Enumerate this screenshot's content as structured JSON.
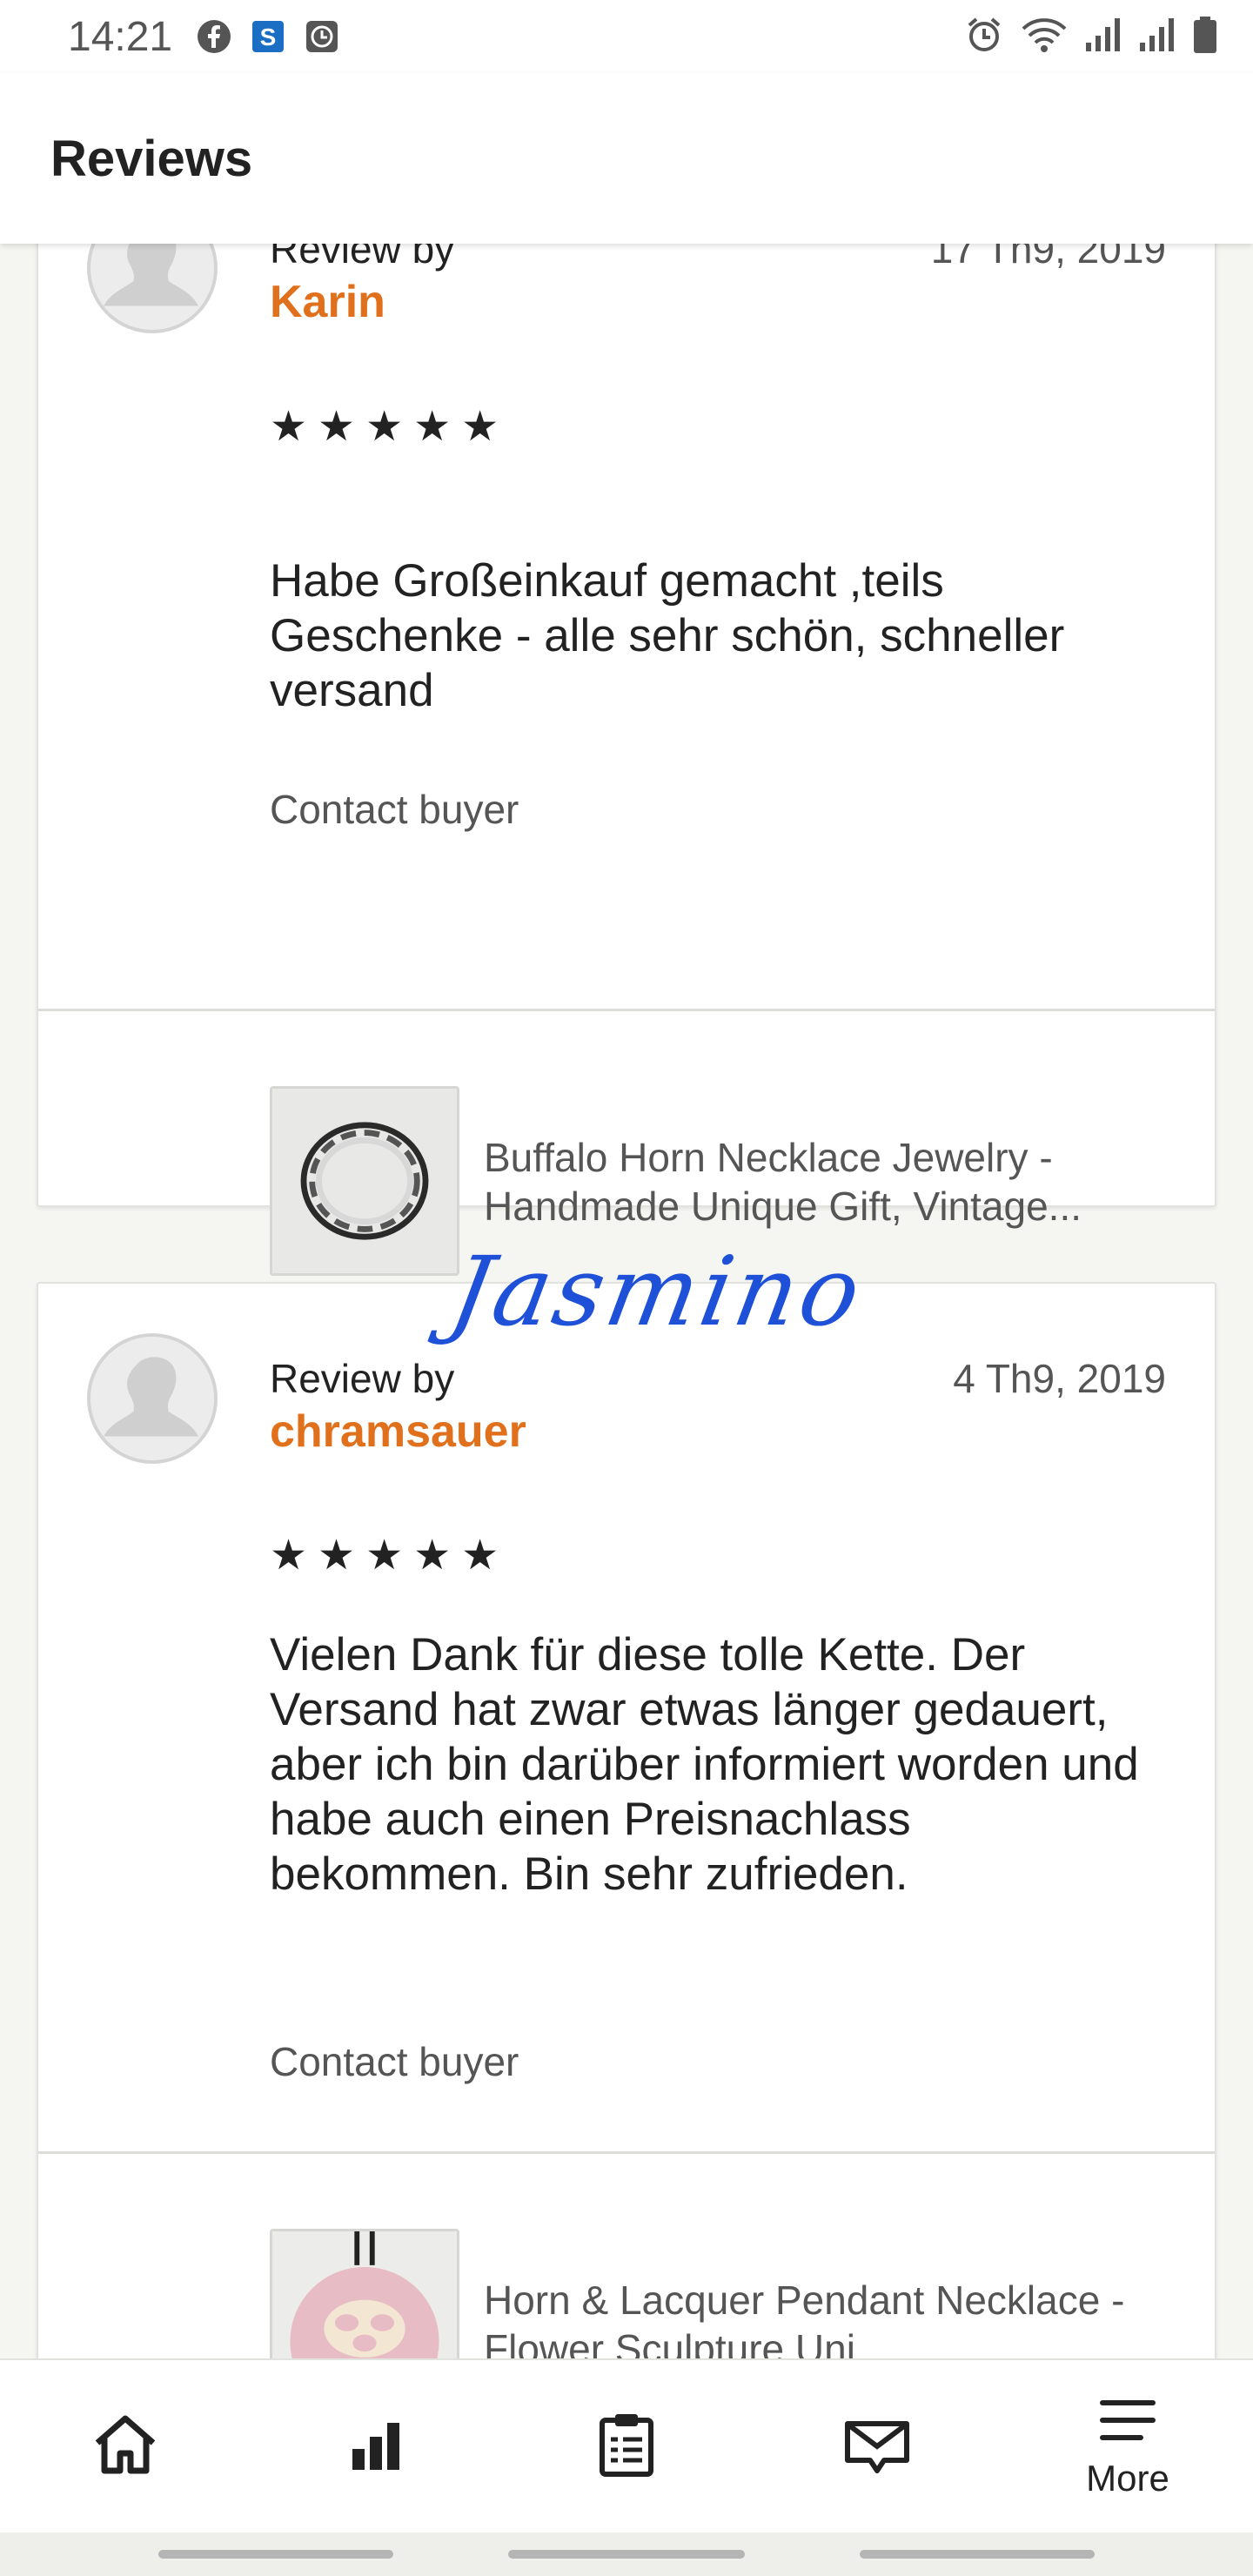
{
  "status_bar": {
    "time": "14:21",
    "notification_icons": [
      "facebook-icon",
      "s-app-icon",
      "clock-app-icon"
    ],
    "system_icons": [
      "alarm-icon",
      "wifi-icon",
      "signal-icon",
      "signal-icon",
      "battery-icon"
    ]
  },
  "app_bar": {
    "title": "Reviews"
  },
  "reviews": [
    {
      "review_by_label": "Review by",
      "reviewer": "Karin",
      "date": "17 Th9, 2019",
      "stars": "★★★★★",
      "rating": 5,
      "text": "Habe Großeinkauf gemacht ,teils Geschenke - alle sehr schön, schneller versand",
      "contact_label": "Contact buyer",
      "item_title": "Buffalo Horn Necklace Jewelry - Handmade Unique Gift, Vintage..."
    },
    {
      "review_by_label": "Review by",
      "reviewer": "chramsauer",
      "date": "4 Th9, 2019",
      "stars": "★★★★★",
      "rating": 5,
      "text": "Vielen Dank für diese tolle Kette. Der Versand hat zwar etwas länger gedauert, aber ich bin darüber informiert worden und habe auch einen Preisnachlass bekommen. Bin sehr zufrieden.",
      "contact_label": "Contact buyer",
      "item_title": "Horn & Lacquer Pendant Necklace - Flower Sculpture Uni..."
    }
  ],
  "signature_text": "Jasmino",
  "bottom_nav": {
    "items": [
      {
        "icon": "home-icon",
        "label": ""
      },
      {
        "icon": "stats-icon",
        "label": ""
      },
      {
        "icon": "orders-icon",
        "label": ""
      },
      {
        "icon": "messages-icon",
        "label": ""
      },
      {
        "icon": "menu-icon",
        "label": "More"
      }
    ]
  },
  "colors": {
    "accent_orange": "#e0701c",
    "background": "#f5f5f1",
    "signature_blue": "#1e50d8"
  }
}
